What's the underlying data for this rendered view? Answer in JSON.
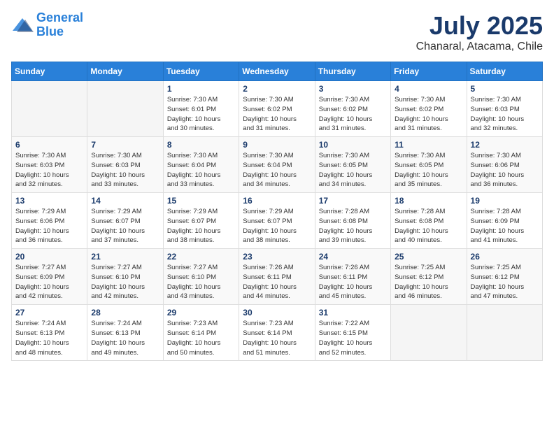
{
  "header": {
    "logo_line1": "General",
    "logo_line2": "Blue",
    "month_year": "July 2025",
    "location": "Chanaral, Atacama, Chile"
  },
  "weekdays": [
    "Sunday",
    "Monday",
    "Tuesday",
    "Wednesday",
    "Thursday",
    "Friday",
    "Saturday"
  ],
  "weeks": [
    [
      {
        "day": "",
        "info": ""
      },
      {
        "day": "",
        "info": ""
      },
      {
        "day": "1",
        "info": "Sunrise: 7:30 AM\nSunset: 6:01 PM\nDaylight: 10 hours\nand 30 minutes."
      },
      {
        "day": "2",
        "info": "Sunrise: 7:30 AM\nSunset: 6:02 PM\nDaylight: 10 hours\nand 31 minutes."
      },
      {
        "day": "3",
        "info": "Sunrise: 7:30 AM\nSunset: 6:02 PM\nDaylight: 10 hours\nand 31 minutes."
      },
      {
        "day": "4",
        "info": "Sunrise: 7:30 AM\nSunset: 6:02 PM\nDaylight: 10 hours\nand 31 minutes."
      },
      {
        "day": "5",
        "info": "Sunrise: 7:30 AM\nSunset: 6:03 PM\nDaylight: 10 hours\nand 32 minutes."
      }
    ],
    [
      {
        "day": "6",
        "info": "Sunrise: 7:30 AM\nSunset: 6:03 PM\nDaylight: 10 hours\nand 32 minutes."
      },
      {
        "day": "7",
        "info": "Sunrise: 7:30 AM\nSunset: 6:03 PM\nDaylight: 10 hours\nand 33 minutes."
      },
      {
        "day": "8",
        "info": "Sunrise: 7:30 AM\nSunset: 6:04 PM\nDaylight: 10 hours\nand 33 minutes."
      },
      {
        "day": "9",
        "info": "Sunrise: 7:30 AM\nSunset: 6:04 PM\nDaylight: 10 hours\nand 34 minutes."
      },
      {
        "day": "10",
        "info": "Sunrise: 7:30 AM\nSunset: 6:05 PM\nDaylight: 10 hours\nand 34 minutes."
      },
      {
        "day": "11",
        "info": "Sunrise: 7:30 AM\nSunset: 6:05 PM\nDaylight: 10 hours\nand 35 minutes."
      },
      {
        "day": "12",
        "info": "Sunrise: 7:30 AM\nSunset: 6:06 PM\nDaylight: 10 hours\nand 36 minutes."
      }
    ],
    [
      {
        "day": "13",
        "info": "Sunrise: 7:29 AM\nSunset: 6:06 PM\nDaylight: 10 hours\nand 36 minutes."
      },
      {
        "day": "14",
        "info": "Sunrise: 7:29 AM\nSunset: 6:07 PM\nDaylight: 10 hours\nand 37 minutes."
      },
      {
        "day": "15",
        "info": "Sunrise: 7:29 AM\nSunset: 6:07 PM\nDaylight: 10 hours\nand 38 minutes."
      },
      {
        "day": "16",
        "info": "Sunrise: 7:29 AM\nSunset: 6:07 PM\nDaylight: 10 hours\nand 38 minutes."
      },
      {
        "day": "17",
        "info": "Sunrise: 7:28 AM\nSunset: 6:08 PM\nDaylight: 10 hours\nand 39 minutes."
      },
      {
        "day": "18",
        "info": "Sunrise: 7:28 AM\nSunset: 6:08 PM\nDaylight: 10 hours\nand 40 minutes."
      },
      {
        "day": "19",
        "info": "Sunrise: 7:28 AM\nSunset: 6:09 PM\nDaylight: 10 hours\nand 41 minutes."
      }
    ],
    [
      {
        "day": "20",
        "info": "Sunrise: 7:27 AM\nSunset: 6:09 PM\nDaylight: 10 hours\nand 42 minutes."
      },
      {
        "day": "21",
        "info": "Sunrise: 7:27 AM\nSunset: 6:10 PM\nDaylight: 10 hours\nand 42 minutes."
      },
      {
        "day": "22",
        "info": "Sunrise: 7:27 AM\nSunset: 6:10 PM\nDaylight: 10 hours\nand 43 minutes."
      },
      {
        "day": "23",
        "info": "Sunrise: 7:26 AM\nSunset: 6:11 PM\nDaylight: 10 hours\nand 44 minutes."
      },
      {
        "day": "24",
        "info": "Sunrise: 7:26 AM\nSunset: 6:11 PM\nDaylight: 10 hours\nand 45 minutes."
      },
      {
        "day": "25",
        "info": "Sunrise: 7:25 AM\nSunset: 6:12 PM\nDaylight: 10 hours\nand 46 minutes."
      },
      {
        "day": "26",
        "info": "Sunrise: 7:25 AM\nSunset: 6:12 PM\nDaylight: 10 hours\nand 47 minutes."
      }
    ],
    [
      {
        "day": "27",
        "info": "Sunrise: 7:24 AM\nSunset: 6:13 PM\nDaylight: 10 hours\nand 48 minutes."
      },
      {
        "day": "28",
        "info": "Sunrise: 7:24 AM\nSunset: 6:13 PM\nDaylight: 10 hours\nand 49 minutes."
      },
      {
        "day": "29",
        "info": "Sunrise: 7:23 AM\nSunset: 6:14 PM\nDaylight: 10 hours\nand 50 minutes."
      },
      {
        "day": "30",
        "info": "Sunrise: 7:23 AM\nSunset: 6:14 PM\nDaylight: 10 hours\nand 51 minutes."
      },
      {
        "day": "31",
        "info": "Sunrise: 7:22 AM\nSunset: 6:15 PM\nDaylight: 10 hours\nand 52 minutes."
      },
      {
        "day": "",
        "info": ""
      },
      {
        "day": "",
        "info": ""
      }
    ]
  ]
}
